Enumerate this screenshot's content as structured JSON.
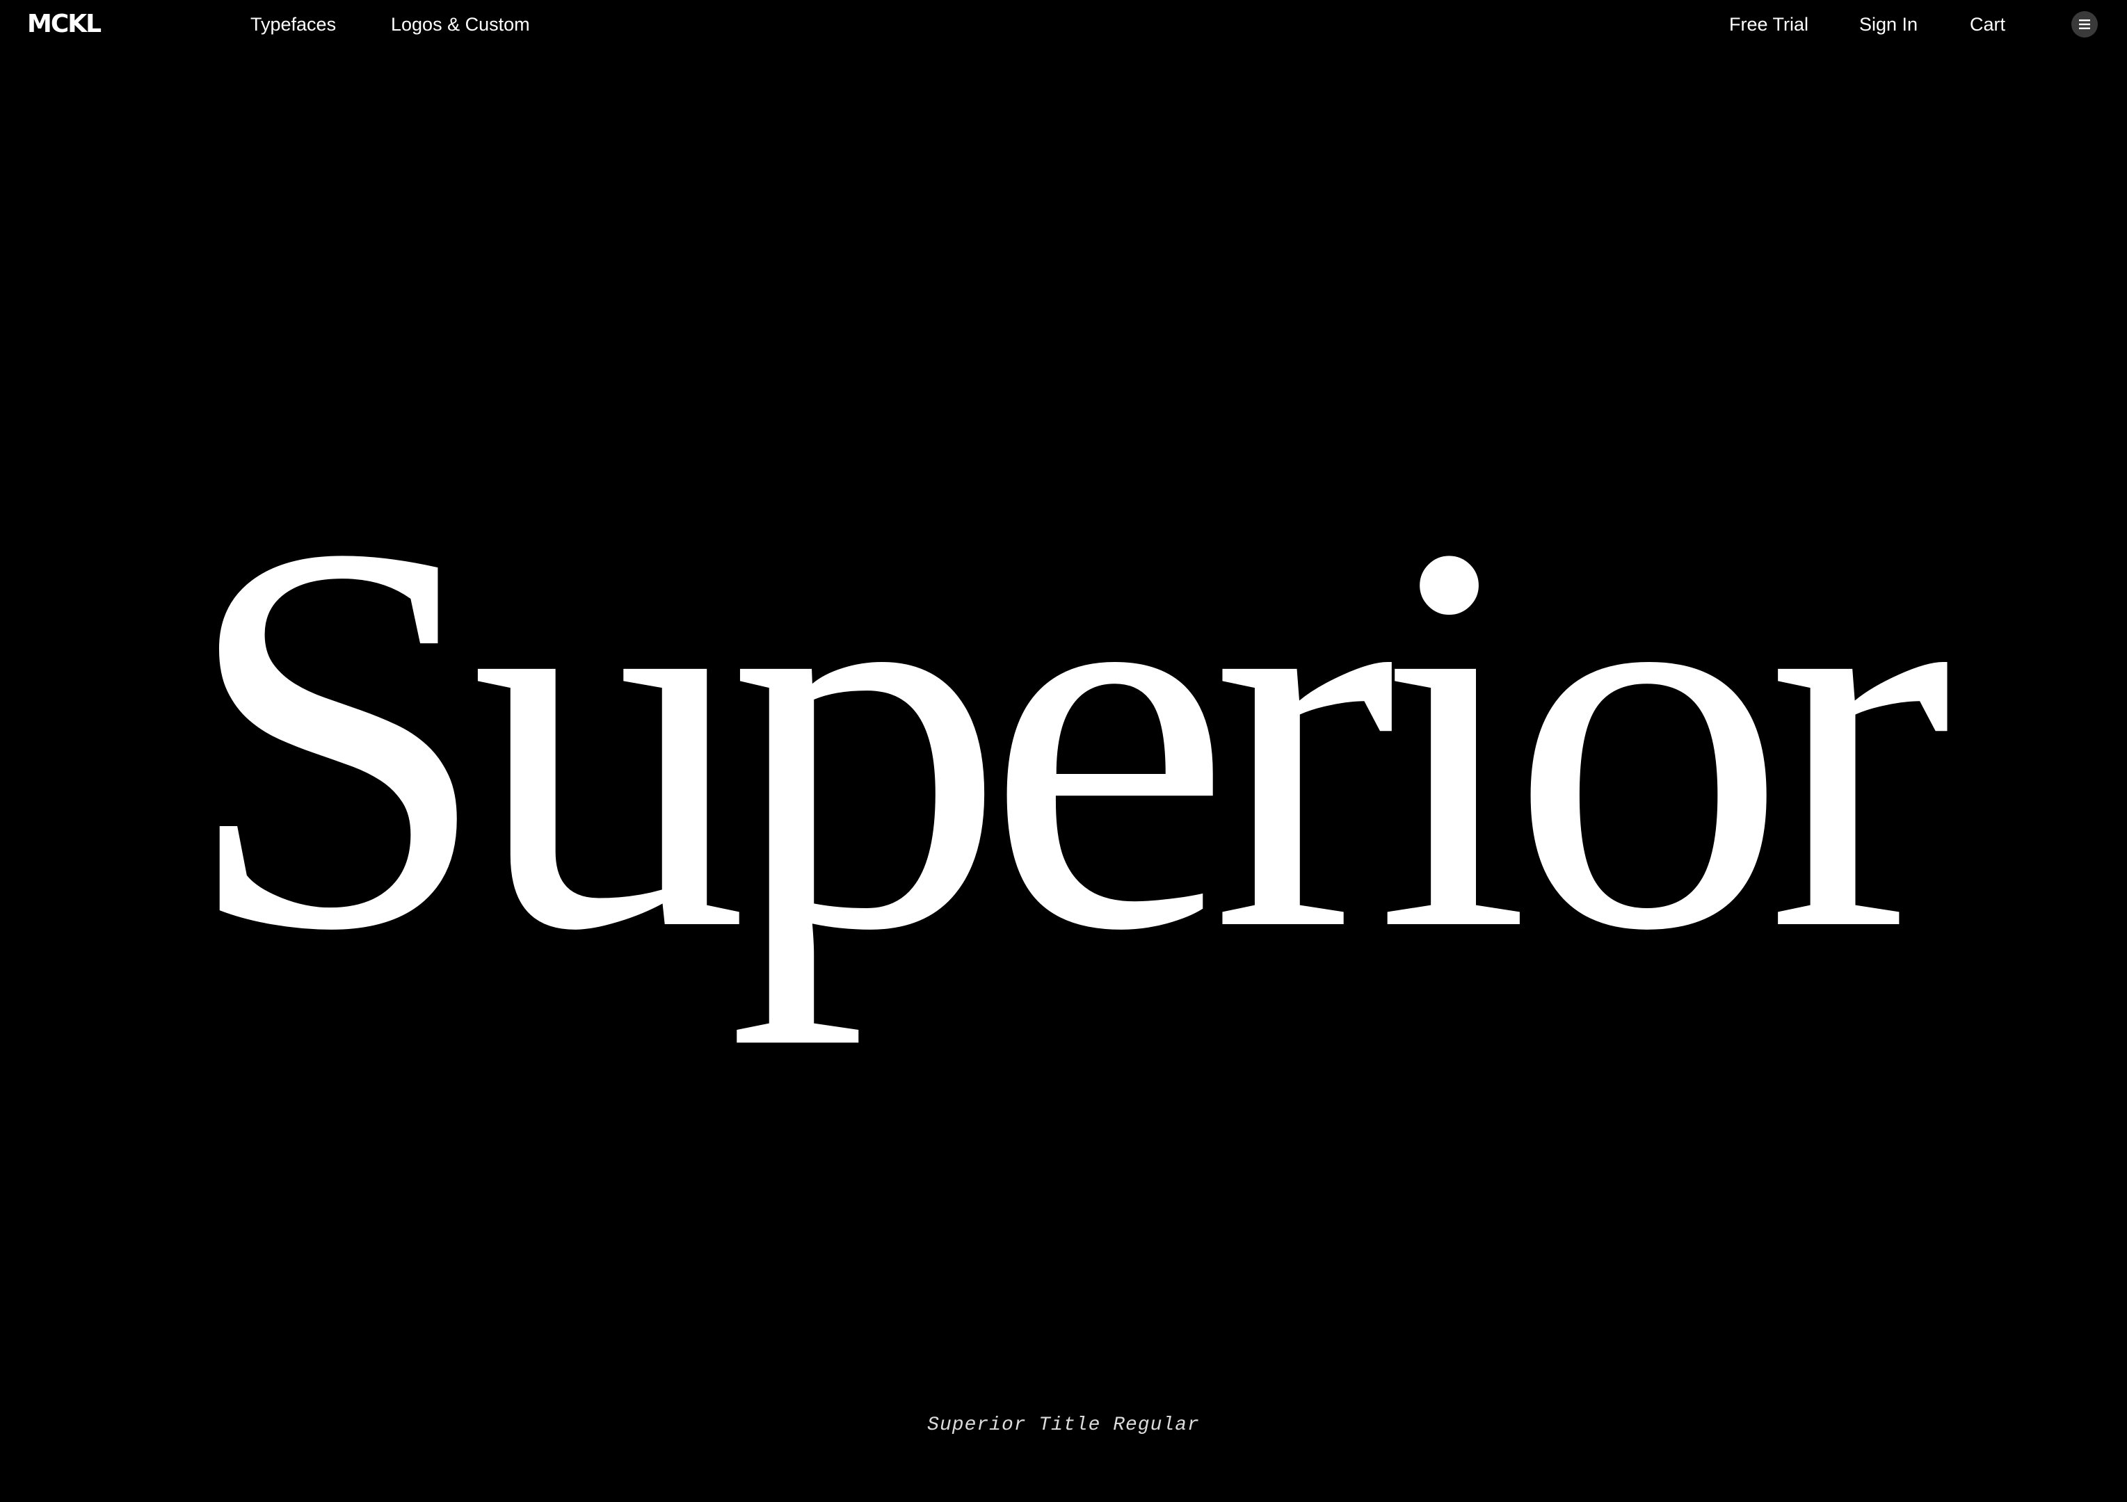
{
  "nav": {
    "logo": "MCKL",
    "links": {
      "typefaces": "Typefaces",
      "logos_custom": "Logos & Custom",
      "free_trial": "Free Trial",
      "sign_in": "Sign In",
      "cart": "Cart"
    },
    "menu_icon": "hamburger-menu-icon"
  },
  "hero": {
    "specimen_word": "Superior",
    "font_caption": "Superior Title Regular"
  },
  "colors": {
    "background": "#000000",
    "text": "#ffffff",
    "menu_button": "#3a3a3a"
  }
}
